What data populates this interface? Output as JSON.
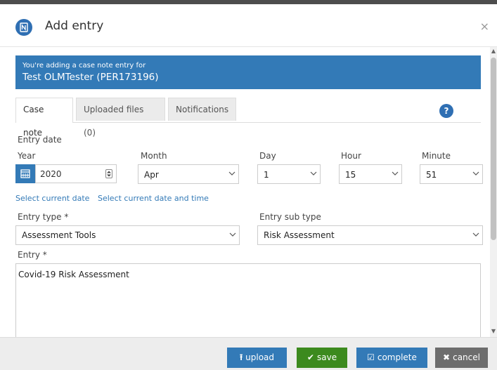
{
  "dialog": {
    "title": "Add entry",
    "close_symbol": "×",
    "logo_icon": "notes-app-icon"
  },
  "banner": {
    "line1": "You're adding a case note entry for",
    "line2": "Test OLMTester (PER173196)",
    "color": "#337ab7"
  },
  "tabs": [
    {
      "label": "Case note",
      "active": true
    },
    {
      "label": "Uploaded files (0)",
      "active": false
    },
    {
      "label": "Notifications",
      "active": false
    }
  ],
  "help_symbol": "?",
  "entry_date": {
    "heading": "Entry date",
    "year_label": "Year",
    "year_value": "2020",
    "month_label": "Month",
    "month_value": "Apr",
    "day_label": "Day",
    "day_value": "1",
    "hour_label": "Hour",
    "hour_value": "15",
    "minute_label": "Minute",
    "minute_value": "51"
  },
  "links": {
    "current_date": "Select current date",
    "current_date_time": "Select current date and time"
  },
  "entry_type": {
    "label": "Entry type *",
    "value": "Assessment Tools"
  },
  "entry_sub_type": {
    "label": "Entry sub type",
    "value": "Risk Assessment"
  },
  "entry": {
    "label": "Entry *",
    "value": "Covid-19 Risk Assessment"
  },
  "buttons": {
    "upload": {
      "label": "upload",
      "color": "#337ab7"
    },
    "save": {
      "label": "save",
      "color": "#3c8a1e"
    },
    "complete": {
      "label": "complete",
      "color": "#337ab7"
    },
    "cancel": {
      "label": "cancel",
      "color": "#6d6d6d"
    }
  }
}
